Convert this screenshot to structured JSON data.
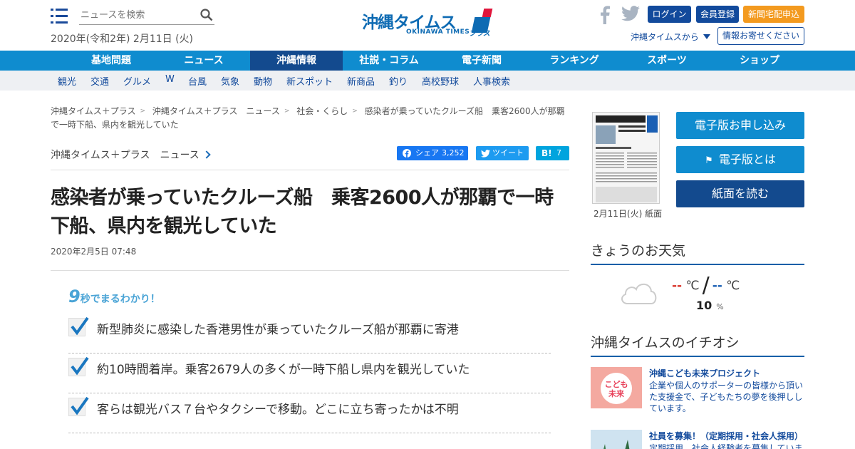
{
  "header": {
    "search_placeholder": "ニュースを検索",
    "date": "2020年(令和2年) 2月11日 (火)",
    "logo_text": "沖縄タイムス",
    "logo_en": "OKINAWA TIMES",
    "logo_plus": "プラス",
    "login": "ログイン",
    "register": "会員登録",
    "delivery": "新聞宅配申込",
    "from_times": "沖縄タイムスから",
    "info": "情報お寄せください"
  },
  "nav": [
    "基地問題",
    "ニュース",
    "沖縄情報",
    "社説・コラム",
    "電子新聞",
    "ランキング",
    "スポーツ",
    "ショップ"
  ],
  "subnav": [
    "観光",
    "交通",
    "グルメ",
    "W",
    "台風",
    "気象",
    "動物",
    "新スポット",
    "新商品",
    "釣り",
    "高校野球",
    "人事検索"
  ],
  "article": {
    "breadcrumb": [
      "沖縄タイムス＋プラス",
      "沖縄タイムス＋プラス　ニュース",
      "社会・くらし",
      "感染者が乗っていたクルーズ船　乗客2600人が那覇で一時下船、県内を観光していた"
    ],
    "category": "沖縄タイムス＋プラス　ニュース",
    "share_fb": "シェア",
    "share_fb_count": "3,252",
    "share_tw": "ツイート",
    "share_hb": "B!",
    "share_hb_count": "7",
    "title": "感染者が乗っていたクルーズ船　乗客2600人が那覇で一時下船、県内を観光していた",
    "published": "2020年2月5日 07:48",
    "summary_num": "9",
    "summary_label": "秒でまるわかり！",
    "points": [
      "新型肺炎に感染した香港男性が乗っていたクルーズ船が那覇に寄港",
      "約10時間着岸。乗客2679人の多くが一時下船し県内を観光していた",
      "客らは観光バス７台やタクシーで移動。どこに立ち寄ったかは不明"
    ]
  },
  "sidebar": {
    "paper_caption": "2月11日(火) 紙面",
    "btn_apply": "電子版お申し込み",
    "btn_about": "電子版とは",
    "btn_read": "紙面を読む",
    "weather_heading": "きょうのお天気",
    "temp_high": "--",
    "temp_low": "--",
    "temp_unit": "℃",
    "precip": "10",
    "precip_unit": "%",
    "pick_heading": "沖縄タイムスのイチオシ",
    "picks": [
      {
        "title": "沖縄こども未来プロジェクト",
        "desc": "企業や個人のサポーターの皆様から頂いた支援金で、子どもたちの夢を後押ししています。",
        "thumb": "こども未来"
      },
      {
        "title": "社員を募集！（定期採用・社会人採用）",
        "desc": "定期採用、社会人経験者を募集しています。"
      }
    ]
  },
  "colors": {
    "nav": "#0f8ccf",
    "nav_active": "#134a8e",
    "accent_orange": "#f39a1f",
    "brand_red": "#e0163c"
  }
}
